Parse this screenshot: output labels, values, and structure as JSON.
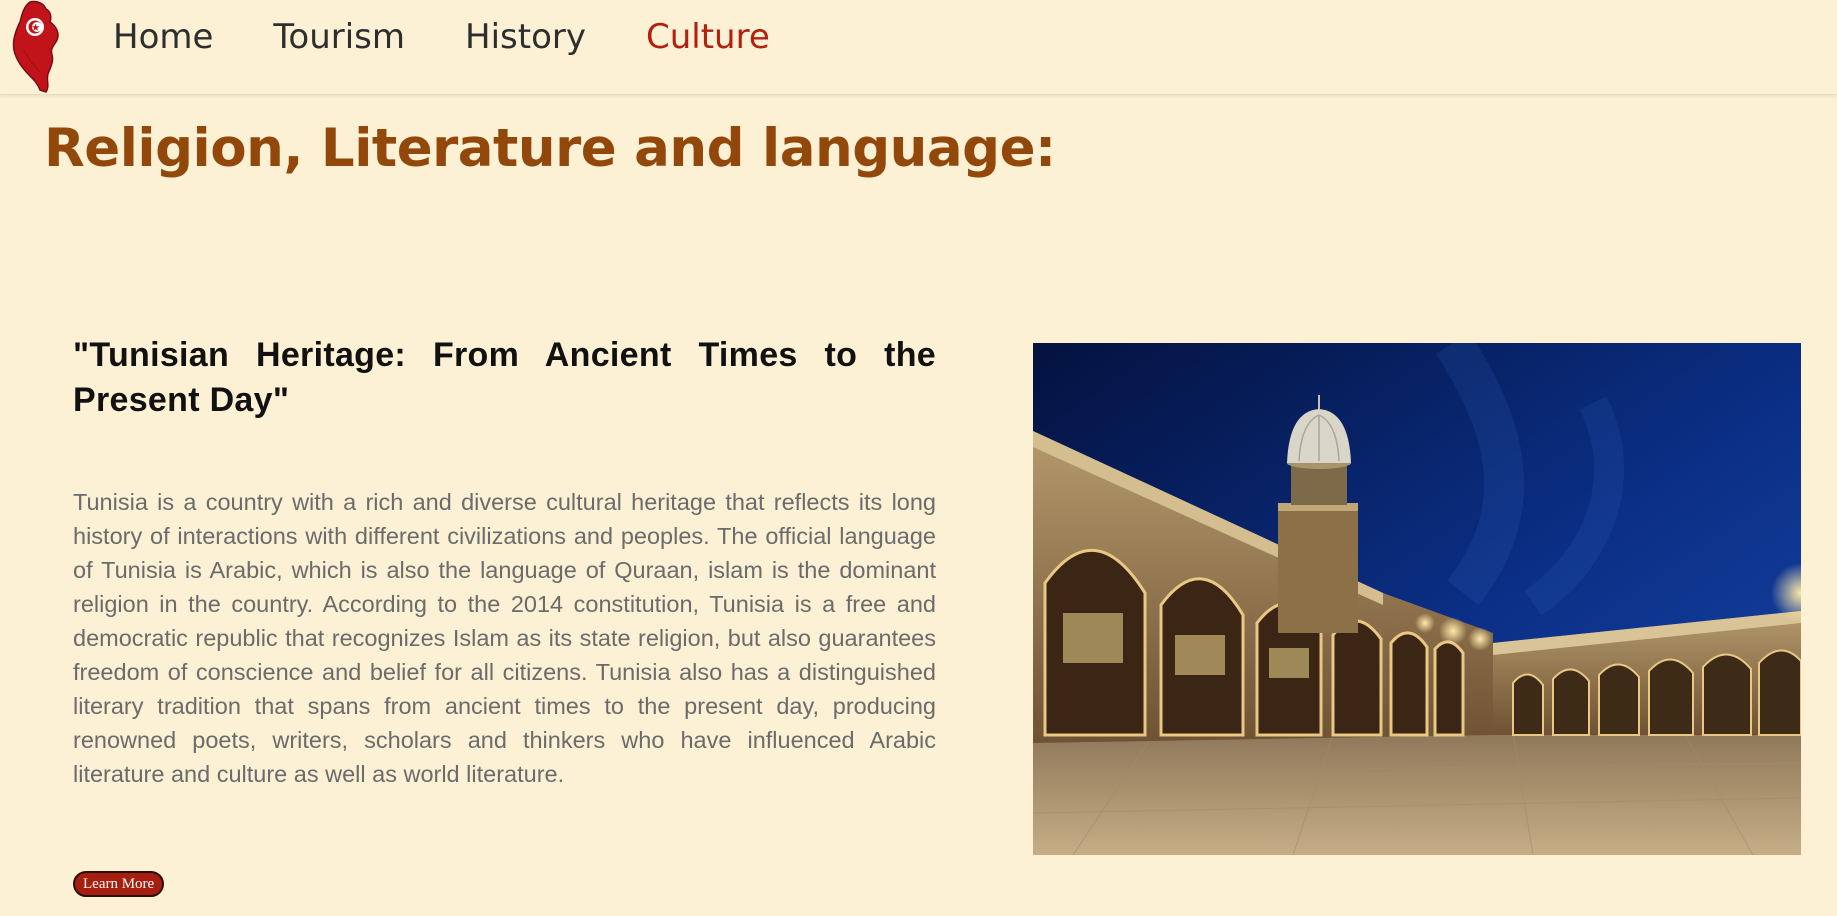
{
  "nav": {
    "items": [
      {
        "label": "Home",
        "active": false
      },
      {
        "label": "Tourism",
        "active": false
      },
      {
        "label": "History",
        "active": false
      },
      {
        "label": "Culture",
        "active": true
      }
    ]
  },
  "page": {
    "title": "Religion, Literature and language:"
  },
  "section": {
    "heading": "\"Tunisian Heritage: From Ancient Times to the Present Day\"",
    "body": "Tunisia is a country with a rich and diverse cultural heritage that reflects its long history of interactions with different civilizations and peoples. The official language of Tunisia is Arabic, which is also the language of Quraan, islam is the dominant religion in the country. According to the 2014 constitution, Tunisia is a free and democratic republic that recognizes Islam as its state religion, but also guarantees freedom of conscience and belief for all citizens. Tunisia also has a distinguished literary tradition that spans from ancient times to the present day, producing renowned poets, writers, scholars and thinkers who have influenced Arabic literature and culture as well as world literature.",
    "button_label": "Learn More"
  },
  "colors": {
    "background": "#fcf1d4",
    "title": "#91480a",
    "active_nav": "#b2200f",
    "button": "#a51e0e"
  },
  "icons": {
    "logo": "tunisia-map-flag-logo",
    "image": "mosque-courtyard-photo"
  }
}
